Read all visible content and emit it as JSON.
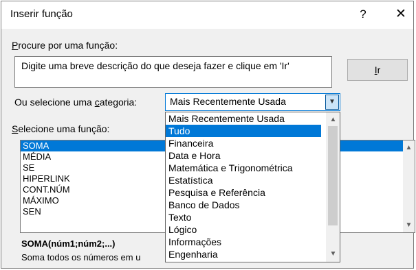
{
  "dialog": {
    "title": "Inserir função",
    "help_glyph": "?",
    "close_glyph": "✕"
  },
  "search": {
    "label": "Procure por uma função:",
    "label_mnemonic": "P",
    "label_rest": "rocure por uma função:",
    "value": "Digite uma breve descrição do que deseja fazer e clique em 'Ir'",
    "go_label": "Ir",
    "go_mnemonic": "I",
    "go_rest": "r"
  },
  "category": {
    "label_pre": "Ou selecione uma ",
    "label_mnemonic": "c",
    "label_post": "ategoria:",
    "selected": "Mais Recentemente Usada",
    "options": [
      "Mais Recentemente Usada",
      "Tudo",
      "Financeira",
      "Data e Hora",
      "Matemática e Trigonométrica",
      "Estatística",
      "Pesquisa e Referência",
      "Banco de Dados",
      "Texto",
      "Lógico",
      "Informações",
      "Engenharia"
    ],
    "highlighted_index": 1
  },
  "functions": {
    "label_mnemonic": "S",
    "label_rest": "elecione uma função:",
    "items": [
      "SOMA",
      "MÉDIA",
      "SE",
      "HIPERLINK",
      "CONT.NÚM",
      "MÁXIMO",
      "SEN"
    ],
    "selected_index": 0
  },
  "details": {
    "syntax": "SOMA(núm1;núm2;...)",
    "description": "Soma todos os números em u"
  },
  "colors": {
    "selection": "#0078d7",
    "dialog_bg": "#f0f0f0"
  }
}
